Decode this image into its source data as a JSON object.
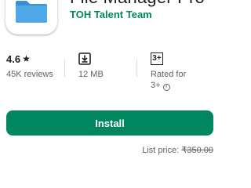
{
  "app": {
    "title": "File Manager Pro",
    "developer": "TOH Talent Team",
    "icon": "folder-icon"
  },
  "stats": {
    "rating": {
      "value": "4.6",
      "icon": "star-icon",
      "sub": "45K reviews"
    },
    "size": {
      "icon": "download-icon",
      "value": "12 MB"
    },
    "content_rating": {
      "badge": "3+",
      "line1": "Rated for",
      "line2": "3+",
      "icon": "info-icon"
    }
  },
  "install": {
    "label": "Install"
  },
  "price": {
    "prefix": "List price: ",
    "value": "₹350.00"
  },
  "colors": {
    "accent": "#01875f",
    "folder": "#4fa8e8"
  }
}
